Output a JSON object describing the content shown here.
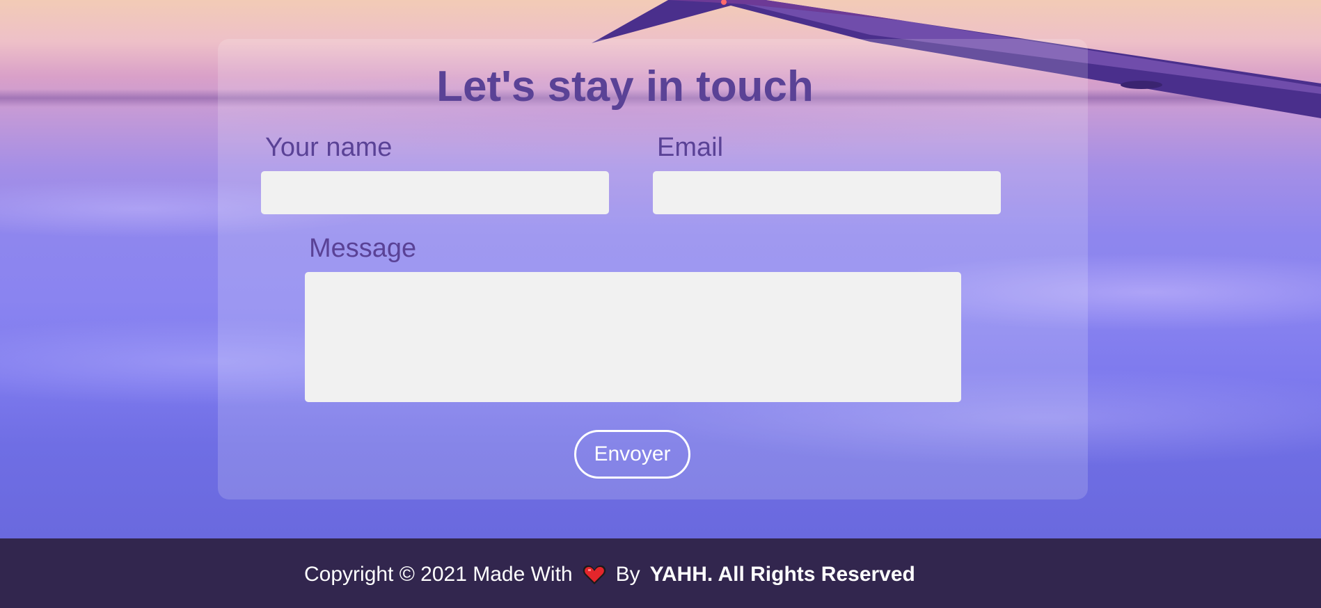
{
  "contact_form": {
    "title": "Let's stay in touch",
    "name_label": "Your name",
    "name_value": "",
    "email_label": "Email",
    "email_value": "",
    "message_label": "Message",
    "message_value": "",
    "submit_label": "Envoyer"
  },
  "footer": {
    "copyright_prefix": "Copyright © 2021 Made With",
    "heart_icon": "heart-icon",
    "by_label": "By",
    "brand_text": "YAHH. All Rights Reserved"
  },
  "colors": {
    "heading": "#5a4296",
    "field_background": "#f1f1f1",
    "footer_background": "#32264e",
    "button_border": "#ffffff",
    "heart": "#e3262b"
  }
}
